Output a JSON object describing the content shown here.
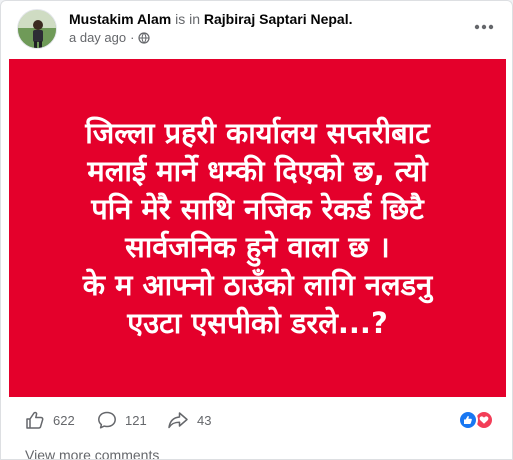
{
  "post": {
    "author": "Mustakim Alam",
    "is_in": "is in",
    "place": "Rajbiraj Saptari Nepal",
    "place_suffix": ".",
    "time": "a day ago",
    "separator": "·",
    "privacy_icon": "globe-icon",
    "more_icon": "more-horizontal-icon"
  },
  "banner": {
    "background": "#e4002b",
    "text_color": "#ffffff",
    "lines": [
      "जिल्ला प्रहरी कार्यालय सप्तरीबाट",
      "मलाई मार्ने धम्की दिएको छ, त्यो",
      "पनि मेरै साथि नजिक रेकर्ड छिटै",
      "सार्वजनिक हुने वाला छ ।",
      "के म आफ्नो ठाउँको लागि नलडनु",
      "एउटा एसपीको डरले...?"
    ]
  },
  "actions": {
    "like_count": "622",
    "comment_count": "121",
    "share_count": "43",
    "like_icon": "thumbs-up-icon",
    "comment_icon": "comment-bubble-icon",
    "share_icon": "share-arrow-icon"
  },
  "reactions": [
    "like-reaction-icon",
    "love-reaction-icon"
  ],
  "footer": {
    "view_more": "View more comments"
  }
}
